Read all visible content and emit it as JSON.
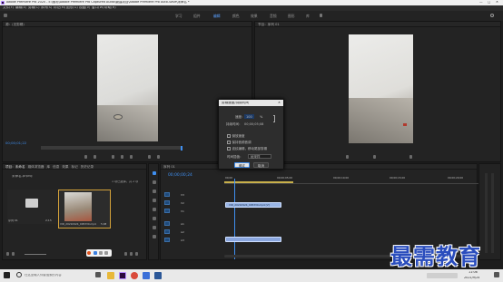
{
  "window": {
    "title": "Adobe Premiere Pro 2020 - E:\\素材\\Adobe Premiere Pro Captured Audio\\新建项目\\Adobe Premiere Pro Auto-Save\\未命名 *"
  },
  "menubar": {
    "items": [
      "文件(F)",
      "编辑(E)",
      "剪辑(C)",
      "序列(S)",
      "标记(M)",
      "图形(G)",
      "视图(V)",
      "窗口(W)",
      "帮助(H)"
    ]
  },
  "workspaces": {
    "items": [
      "学习",
      "组件",
      "编辑",
      "颜色",
      "效果",
      "音频",
      "图形",
      "库"
    ],
    "active_index": 2
  },
  "source_monitor": {
    "title": "源：(无剪辑)",
    "timecode": "00;00;01;22"
  },
  "program_monitor": {
    "title": "节目：序列 01",
    "timecode": "00;00;01;22"
  },
  "project_panel": {
    "tabs": [
      "项目：未命名",
      "媒体浏览器",
      "库",
      "信息",
      "效果",
      "标记",
      "历史记录"
    ],
    "path": "未命名.prproj",
    "item_count": "1 项已选择，共 2 项",
    "items": [
      {
        "label": "序列 01",
        "duration": "2;15"
      },
      {
        "label": "VID_20210924_095330.mp4",
        "duration": "5;08"
      }
    ]
  },
  "timeline": {
    "tab": "序列 01",
    "timecode": "00;00;00;24",
    "ruler": [
      "00;00",
      "00;00;05;00",
      "00;00;10;00",
      "00;00;15;00",
      "00;00;20;00"
    ],
    "video_tracks": [
      "V3",
      "V2",
      "V1"
    ],
    "audio_tracks": [
      "A1",
      "A2",
      "A3"
    ],
    "video_clip": "VID_20210924_095330.mp4 [V]",
    "audio_clip": ""
  },
  "dialog": {
    "title": "剪辑速度/持续时间",
    "speed_label": "速度：",
    "speed_value": "100",
    "speed_unit": "%",
    "duration_label": "持续时间：",
    "duration_value": "00;00;05;08",
    "reverse": "倒放速度",
    "maintain_pitch": "保持音频音调",
    "ripple": "波纹编辑，移动尾部剪辑",
    "interp_label": "时间插值：",
    "interp_value": "帧采样",
    "ok": "确定",
    "cancel": "取消"
  },
  "taskbar": {
    "search_placeholder": "在这里输入你要搜索的内容",
    "time": "11:06",
    "date": "2021/9/24"
  },
  "watermark": {
    "text": "最需教育"
  },
  "colors": {
    "accent": "#3f8ff0",
    "clip": "#9ab6e6"
  }
}
